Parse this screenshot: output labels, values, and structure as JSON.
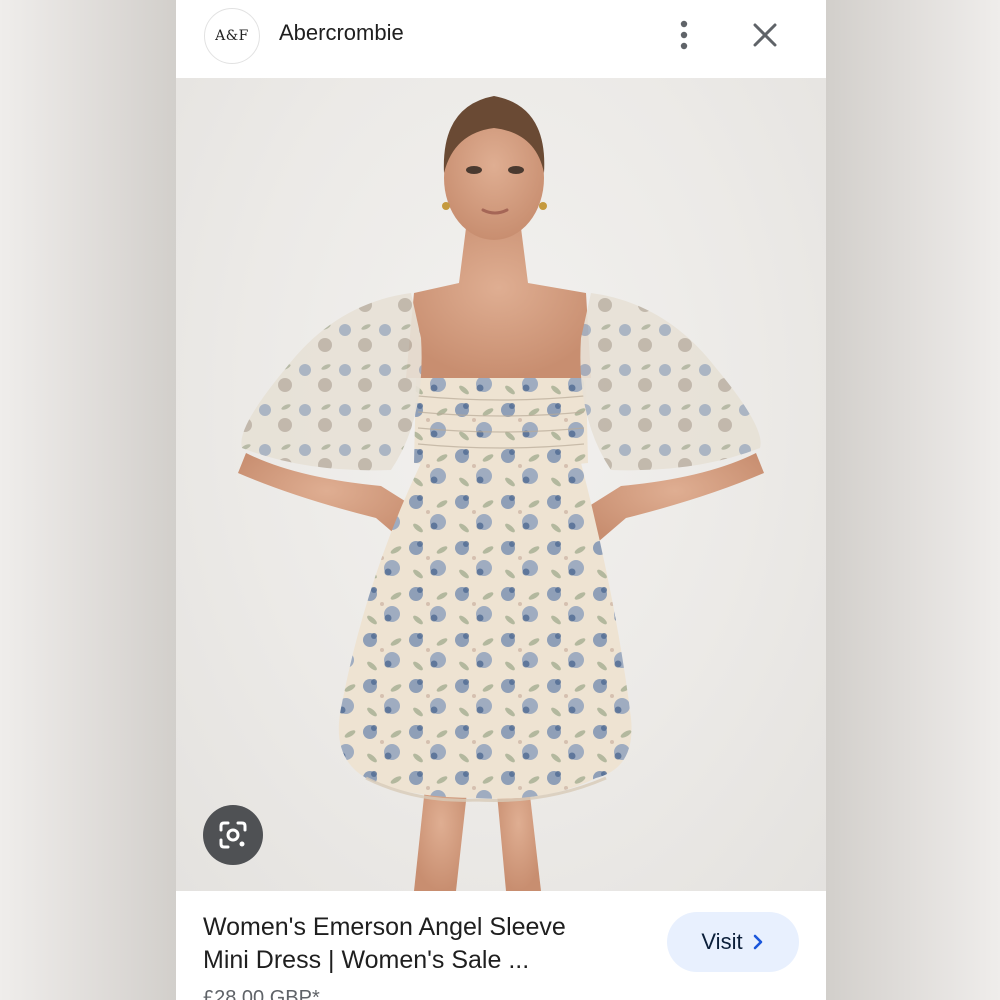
{
  "header": {
    "logo_text": "A&F",
    "source_name": "Abercrombie"
  },
  "icons": {
    "more": "more-vertical-icon",
    "close": "close-icon",
    "lens": "google-lens-icon",
    "chevron": "chevron-right-icon"
  },
  "product": {
    "title_line1": "Women's Emerson Angel Sleeve",
    "title_line2": "Mini Dress | Women's Sale ...",
    "price": "£28.00 GBP*"
  },
  "actions": {
    "visit_label": "Visit"
  },
  "colors": {
    "visit_bg": "#e8f0fe",
    "lens_bg": "#4f5154",
    "dress_base": "#efe6d8",
    "floral_blue": "#5f7da6"
  }
}
